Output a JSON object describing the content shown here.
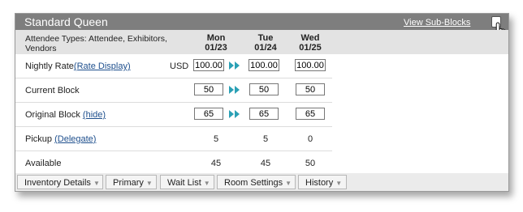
{
  "panel": {
    "title": "Standard Queen",
    "view_sub_blocks": "View Sub-Blocks"
  },
  "columns": {
    "attendee_types": "Attendee Types: Attendee, Exhibitors, Vendors",
    "days": [
      {
        "dow": "Mon",
        "date": "01/23"
      },
      {
        "dow": "Tue",
        "date": "01/24"
      },
      {
        "dow": "Wed",
        "date": "01/25"
      }
    ]
  },
  "rows": {
    "nightly_rate": {
      "label": "Nightly Rate",
      "link": "(Rate Display)",
      "currency": "USD",
      "values": [
        "100.00",
        "100.00",
        "100.00"
      ]
    },
    "current_block": {
      "label": "Current Block",
      "values": [
        "50",
        "50",
        "50"
      ]
    },
    "original_block": {
      "label": "Original Block",
      "link": "(hide)",
      "values": [
        "65",
        "65",
        "65"
      ]
    },
    "pickup": {
      "label": "Pickup",
      "link": "(Delegate)",
      "values": [
        "5",
        "5",
        "0"
      ]
    },
    "available": {
      "label": "Available",
      "values": [
        "45",
        "45",
        "50"
      ]
    }
  },
  "tabs": [
    "Inventory Details",
    "Primary",
    "Wait List",
    "Room Settings",
    "History"
  ],
  "colors": {
    "header_bg": "#7e7e7e",
    "subheader_bg": "#e3e3e3",
    "link": "#1e4f8d",
    "arrow": "#2aa0b5"
  }
}
